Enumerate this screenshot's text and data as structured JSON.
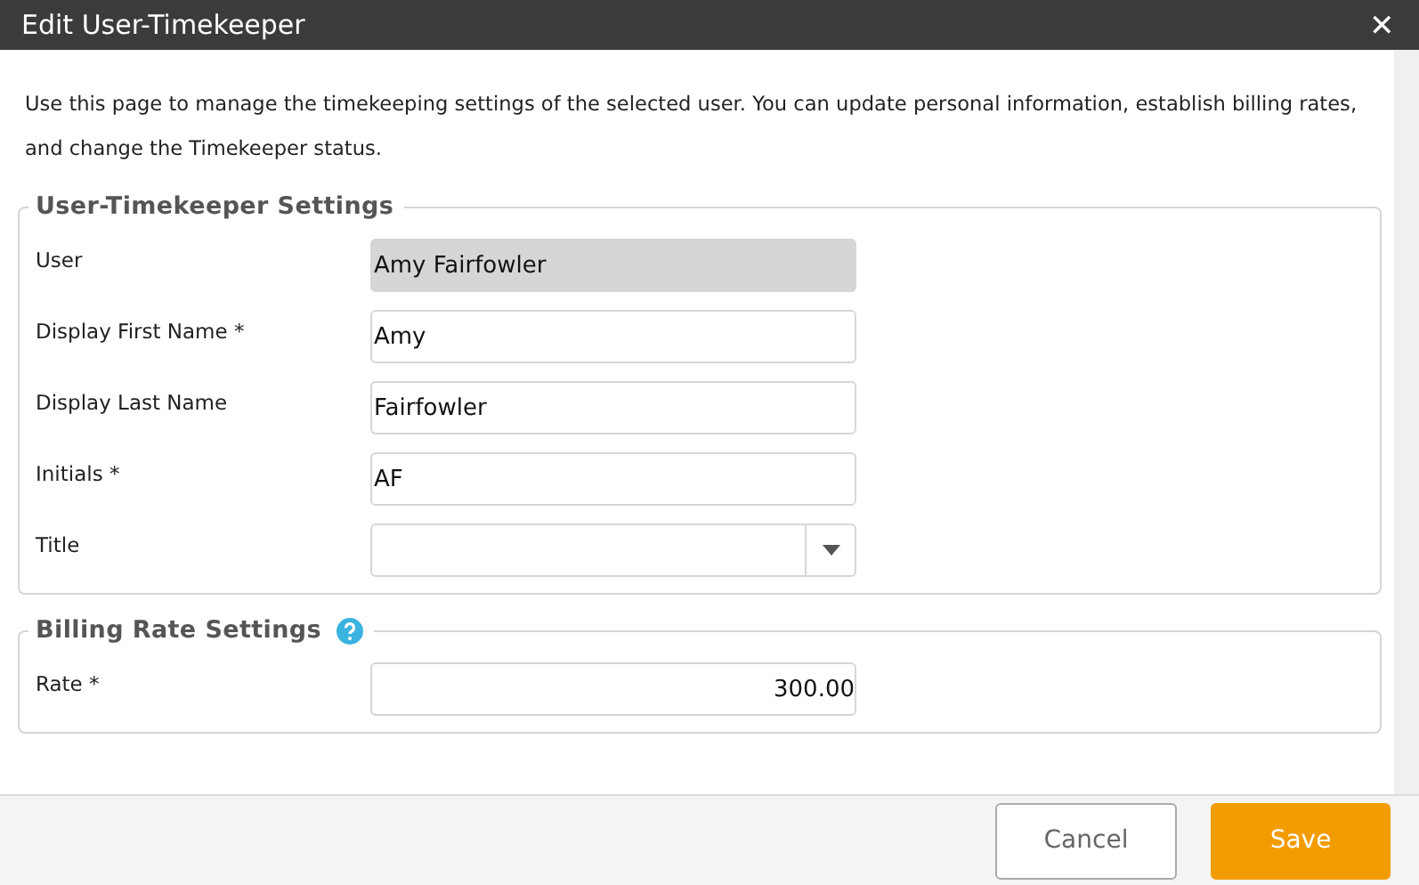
{
  "window": {
    "title": "Edit User-Timekeeper",
    "close": "✕"
  },
  "description": "Use this page to manage the timekeeping settings of the selected user. You can update personal information, establish billing rates, and change the Timekeeper status.",
  "sections": [
    {
      "title": "User-Timekeeper Settings",
      "has_help": false,
      "fields": [
        {
          "label": "User",
          "kind": "readonly",
          "value": "Amy Fairfowler"
        },
        {
          "label": "Display First Name *",
          "kind": "text",
          "value": "Amy"
        },
        {
          "label": "Display Last Name",
          "kind": "text",
          "value": "Fairfowler"
        },
        {
          "label": "Initials *",
          "kind": "text",
          "value": "AF"
        },
        {
          "label": "Title",
          "kind": "select"
        }
      ]
    },
    {
      "title": "Billing Rate Settings",
      "has_help": true,
      "fields": [
        {
          "label": "Rate *",
          "kind": "number",
          "value": "300.00"
        }
      ]
    }
  ],
  "buttons": [
    {
      "label": "Cancel",
      "kind": "secondary"
    },
    {
      "label": "Save",
      "kind": "primary"
    }
  ]
}
